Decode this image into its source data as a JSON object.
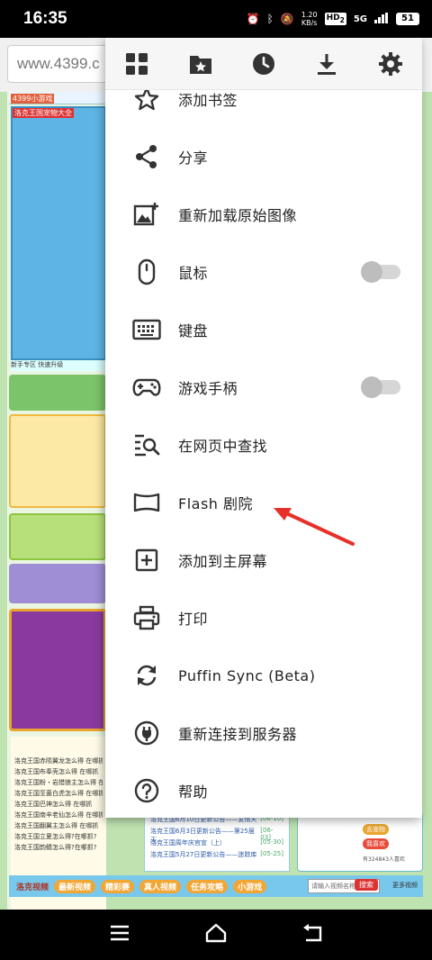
{
  "status_bar": {
    "time": "16:35",
    "net_speed_value": "1.20",
    "net_speed_unit": "KB/s",
    "hd": "HD",
    "hd_sub": "2",
    "signal": "5G",
    "battery": "51"
  },
  "browser": {
    "url": "www.4399.c"
  },
  "background_page": {
    "brand": "4399小游戏",
    "banner_title": "洛克王国宠物大全",
    "tabs": "新手专区    快速升级",
    "news": [
      "洛克王国赤陨翼龙怎么得 在哪抓",
      "洛克王国布奉壳怎么得 在哪抓",
      "洛克王国粉・岩猎狼主怎么得 在哪抓",
      "洛克王国至菌白虎怎么得 在哪抓",
      "洛克王国巴神怎么得 在哪抓",
      "洛克王国南辛老仙怎么得 在哪抓",
      "洛克王国翻翼主怎么得 在哪抓",
      "洛克王国立夏怎么得?在哪抓?",
      "洛克王国韵鳍怎么得?在哪抓?"
    ],
    "updates": [
      {
        "title": "洛克王国6月10日更新公告——友情天",
        "date": "[06-10]"
      },
      {
        "title": "洛克王国6月3日更新公告——第25届天",
        "date": "[06-03]"
      },
      {
        "title": "洛克王国周年庆官宣（上）",
        "date": "[05-30]"
      },
      {
        "title": "洛克王国5月27日更新公告——迷踪库",
        "date": "[05-25]"
      }
    ],
    "card": {
      "badge1": "去宠物",
      "badge2": "我喜欢",
      "count": "有324843人喜欢"
    },
    "nav": {
      "section": "洛克视频",
      "tags": [
        "最新视频",
        "精彩赛",
        "真人视频",
        "任务攻略",
        "小游戏"
      ],
      "search_placeholder": "请输入视频名称",
      "search_btn": "搜索",
      "more": "更多视频"
    }
  },
  "menu": {
    "top_icons": [
      "grid-icon",
      "bookmark-folder-icon",
      "history-clock-icon",
      "download-icon",
      "settings-gear-icon"
    ],
    "items": [
      {
        "label": "添加书签",
        "icon": "star-icon"
      },
      {
        "label": "分享",
        "icon": "share-icon"
      },
      {
        "label": "重新加载原始图像",
        "icon": "reload-image-icon"
      },
      {
        "label": "鼠标",
        "icon": "mouse-icon",
        "toggle": false
      },
      {
        "label": "键盘",
        "icon": "keyboard-icon"
      },
      {
        "label": "游戏手柄",
        "icon": "gamepad-icon",
        "toggle": false
      },
      {
        "label": "在网页中查找",
        "icon": "find-in-page-icon"
      },
      {
        "label": "Flash 剧院",
        "icon": "flash-theater-icon"
      },
      {
        "label": "添加到主屏幕",
        "icon": "add-to-home-icon"
      },
      {
        "label": "打印",
        "icon": "print-icon"
      },
      {
        "label": "Puffin Sync (Beta)",
        "icon": "sync-icon"
      },
      {
        "label": "重新连接到服务器",
        "icon": "plug-icon"
      },
      {
        "label": "帮助",
        "icon": "help-icon"
      }
    ]
  },
  "colors": {
    "annotation_arrow": "#e8302a",
    "icon": "#333333",
    "toggle_off": "#bdbdbd"
  }
}
